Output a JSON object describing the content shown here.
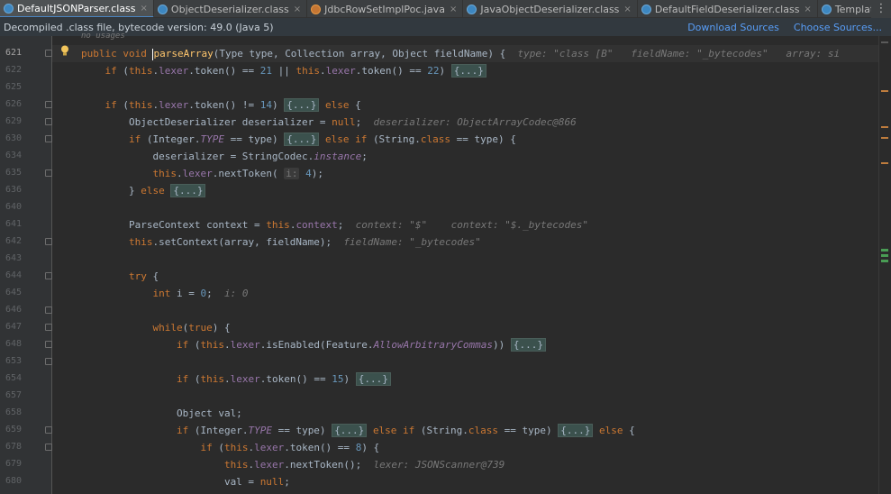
{
  "tabs": [
    {
      "label": "DefaultJSONParser.class",
      "active": true,
      "icon": "class-file-icon"
    },
    {
      "label": "ObjectDeserializer.class",
      "active": false,
      "icon": "class-file-icon"
    },
    {
      "label": "JdbcRowSetImplPoc.java",
      "active": false,
      "icon": "java-file-icon"
    },
    {
      "label": "JavaObjectDeserializer.class",
      "active": false,
      "icon": "class-file-icon"
    },
    {
      "label": "DefaultFieldDeserializer.class",
      "active": false,
      "icon": "class-file-icon"
    },
    {
      "label": "TemplatesIr",
      "active": false,
      "icon": "class-file-icon"
    }
  ],
  "banner": {
    "text": "Decompiled .class file, bytecode version: 49.0 (Java 5)",
    "download_sources": "Download Sources",
    "choose_sources": "Choose Sources..."
  },
  "editor": {
    "usage_hint": "no usages",
    "lines": [
      {
        "n": "621",
        "current": true
      },
      {
        "n": "622"
      },
      {
        "n": "625"
      },
      {
        "n": "626"
      },
      {
        "n": "629"
      },
      {
        "n": "630"
      },
      {
        "n": "634"
      },
      {
        "n": "635"
      },
      {
        "n": "636"
      },
      {
        "n": "640"
      },
      {
        "n": "641"
      },
      {
        "n": "642"
      },
      {
        "n": "643"
      },
      {
        "n": "644"
      },
      {
        "n": "645"
      },
      {
        "n": "646"
      },
      {
        "n": "647"
      },
      {
        "n": "648"
      },
      {
        "n": "653"
      },
      {
        "n": "654"
      },
      {
        "n": "657"
      },
      {
        "n": "658"
      },
      {
        "n": "659"
      },
      {
        "n": "678"
      },
      {
        "n": "679"
      },
      {
        "n": "680"
      }
    ],
    "hints": {
      "type": "type: \"class [B\"",
      "fieldName": "fieldName: \"_bytecodes\"",
      "array": "array: si",
      "deserializer": "deserializer: ObjectArrayCodec@866",
      "context": "context: \"$\"",
      "context2": "context: \"$._bytecodes\"",
      "fieldName2": "fieldName: \"_bytecodes\"",
      "i": "i: 0",
      "lexer": "lexer: JSONScanner@739"
    }
  },
  "colors": {
    "background": "#2b2b2b",
    "keyword": "#cc7832",
    "method": "#ffc66d",
    "number": "#6897bb",
    "string": "#6a8759",
    "field": "#9876aa",
    "link": "#589df6"
  }
}
